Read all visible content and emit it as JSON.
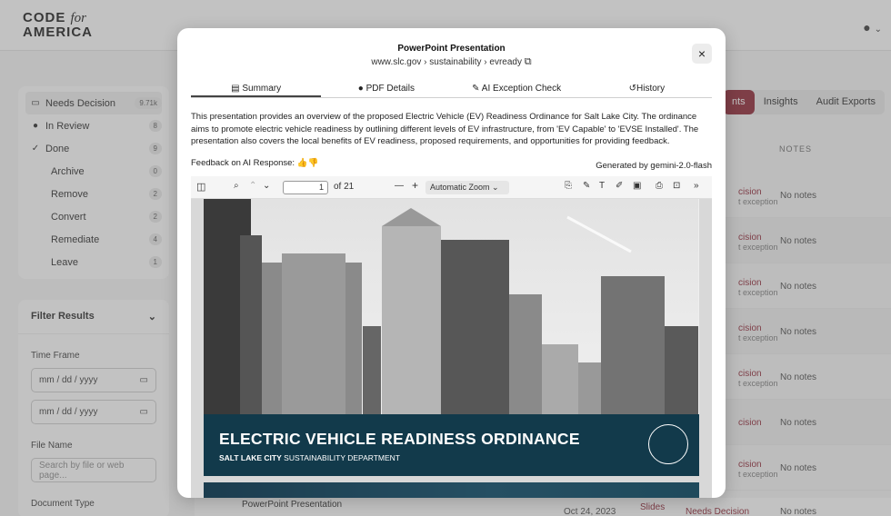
{
  "app": {
    "logo_line1": "CODE",
    "logo_for": "for",
    "logo_line2": "AMERICA",
    "user_icon": "user-circle-icon"
  },
  "nav": [
    {
      "label": "Needs Decision",
      "count": "9.71k",
      "icon": "inbox-icon",
      "selected": true
    },
    {
      "label": "In Review",
      "count": "8",
      "icon": "clock-icon"
    },
    {
      "label": "Done",
      "count": "9",
      "icon": "check-icon"
    },
    {
      "label": "Archive",
      "count": "0"
    },
    {
      "label": "Remove",
      "count": "2"
    },
    {
      "label": "Convert",
      "count": "2"
    },
    {
      "label": "Remediate",
      "count": "4"
    },
    {
      "label": "Leave",
      "count": "1"
    }
  ],
  "filters": {
    "title": "Filter Results",
    "time_frame_label": "Time Frame",
    "date_from_placeholder": "mm / dd / yyyy",
    "date_to_placeholder": "mm / dd / yyyy",
    "file_name_label": "File Name",
    "file_name_placeholder": "Search by file or web page...",
    "document_type_label": "Document Type"
  },
  "right_tabs": [
    "nts",
    "Insights",
    "Audit Exports"
  ],
  "table": {
    "notes_header": "NOTES",
    "rows": [
      {
        "status": "cision",
        "sub": "t exception",
        "notes": "No notes"
      },
      {
        "status": "cision",
        "sub": "t exception",
        "notes": "No notes"
      },
      {
        "status": "cision",
        "sub": "t exception",
        "notes": "No notes"
      },
      {
        "status": "cision",
        "sub": "t exception",
        "notes": "No notes"
      },
      {
        "status": "cision",
        "sub": "t exception",
        "notes": "No notes"
      },
      {
        "status": "cision",
        "sub": "",
        "notes": "No notes"
      },
      {
        "status": "cision",
        "sub": "t exception",
        "notes": "No notes"
      }
    ],
    "bottom_row": {
      "type_label": "PowerPoint Presentation",
      "date": "Oct 24, 2023",
      "kind": "Slides",
      "status": "Needs Decision",
      "notes": "No notes"
    }
  },
  "modal": {
    "title": "PowerPoint Presentation",
    "url": "www.slc.gov › sustainability › evready",
    "close_symbol": "×",
    "tabs": [
      "Summary",
      "PDF Details",
      "AI Exception Check",
      "History"
    ],
    "summary": "This presentation provides an overview of the proposed Electric Vehicle (EV) Readiness Ordinance for Salt Lake City. The ordinance aims to promote electric vehicle readiness by outlining different levels of EV infrastructure, from 'EV Capable' to 'EVSE Installed'. The presentation also covers the local benefits of EV readiness, proposed requirements, and opportunities for providing feedback.",
    "feedback_label": "Feedback on AI Response:",
    "generated_by": "Generated by gemini-2.0-flash",
    "pdf": {
      "page_current": "1",
      "page_total": "of 21",
      "zoom": "Automatic Zoom",
      "slide_title": "ELECTRIC VEHICLE READINESS ORDINANCE",
      "slide_sub_bold": "SALT LAKE CITY",
      "slide_sub_rest": " SUSTAINABILITY DEPARTMENT"
    }
  }
}
